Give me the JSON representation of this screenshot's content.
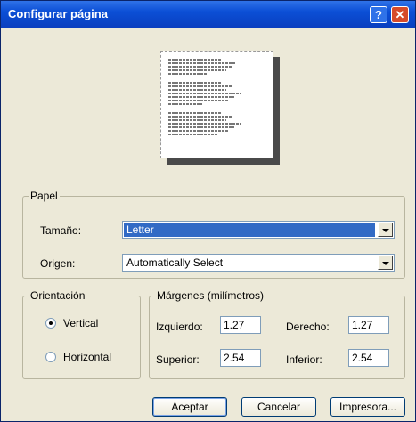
{
  "window": {
    "title": "Configurar página",
    "help_label": "?",
    "close_label": "✕"
  },
  "paper": {
    "legend": "Papel",
    "size_label": "Tamaño:",
    "size_value": "Letter",
    "source_label": "Origen:",
    "source_value": "Automatically Select"
  },
  "orientation": {
    "legend": "Orientación",
    "vertical_label": "Vertical",
    "horizontal_label": "Horizontal",
    "selected": "Vertical"
  },
  "margins": {
    "legend": "Márgenes (milímetros)",
    "left_label": "Izquierdo:",
    "left_value": "1.27",
    "right_label": "Derecho:",
    "right_value": "1.27",
    "top_label": "Superior:",
    "top_value": "2.54",
    "bottom_label": "Inferior:",
    "bottom_value": "2.54"
  },
  "buttons": {
    "ok": "Aceptar",
    "cancel": "Cancelar",
    "printer": "Impresora..."
  },
  "colors": {
    "title_bar": "#0b4fd6",
    "selection": "#316ac5",
    "dialog_bg": "#ece9d8"
  }
}
